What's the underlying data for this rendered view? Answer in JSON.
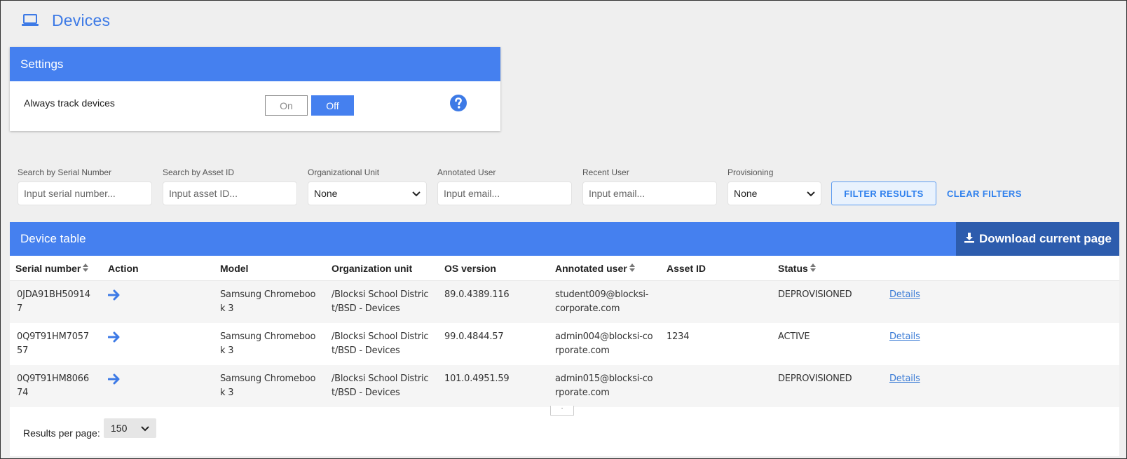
{
  "header": {
    "title": "Devices",
    "icon": "laptop-icon"
  },
  "settings": {
    "title": "Settings",
    "track_label": "Always track devices",
    "on_label": "On",
    "off_label": "Off",
    "selected": "Off",
    "help_icon": "question-circle-icon"
  },
  "filters": {
    "serial": {
      "label": "Search by Serial Number",
      "placeholder": "Input serial number..."
    },
    "asset": {
      "label": "Search by Asset ID",
      "placeholder": "Input asset ID..."
    },
    "org_unit": {
      "label": "Organizational Unit",
      "value": "None"
    },
    "annotated_user": {
      "label": "Annotated User",
      "placeholder": "Input email..."
    },
    "recent_user": {
      "label": "Recent User",
      "placeholder": "Input email..."
    },
    "provisioning": {
      "label": "Provisioning",
      "value": "None"
    },
    "filter_button": "FILTER RESULTS",
    "clear_button": "CLEAR FILTERS"
  },
  "table": {
    "title": "Device table",
    "download_label": "Download current page",
    "columns": {
      "serial": "Serial number",
      "action": "Action",
      "model": "Model",
      "org": "Organization unit",
      "os": "OS version",
      "user": "Annotated user",
      "asset": "Asset ID",
      "status": "Status"
    },
    "rows": [
      {
        "serial": "0JDA91BH509147",
        "model": "Samsung Chromebook 3",
        "org": "/Blocksi School District/BSD - Devices",
        "os": "89.0.4389.116",
        "user": "student009@blocksi-corporate.com",
        "asset": "",
        "status": "DEPROVISIONED",
        "details": "Details"
      },
      {
        "serial": "0Q9T91HM705757",
        "model": "Samsung Chromebook 3",
        "org": "/Blocksi School District/BSD - Devices",
        "os": "99.0.4844.57",
        "user": "admin004@blocksi-corporate.com",
        "asset": "1234",
        "status": "ACTIVE",
        "details": "Details"
      },
      {
        "serial": "0Q9T91HM806674",
        "model": "Samsung Chromebook 3",
        "org": "/Blocksi School District/BSD - Devices",
        "os": "101.0.4951.59",
        "user": "admin015@blocksi-corporate.com",
        "asset": "",
        "status": "DEPROVISIONED",
        "details": "Details"
      }
    ],
    "results_per_page_label": "Results per page:",
    "results_per_page_value": "150"
  },
  "colors": {
    "accent": "#4580ef",
    "download_bg": "#2d5cad",
    "title_blue": "#3d7ae6",
    "link": "#3a7bd5"
  }
}
